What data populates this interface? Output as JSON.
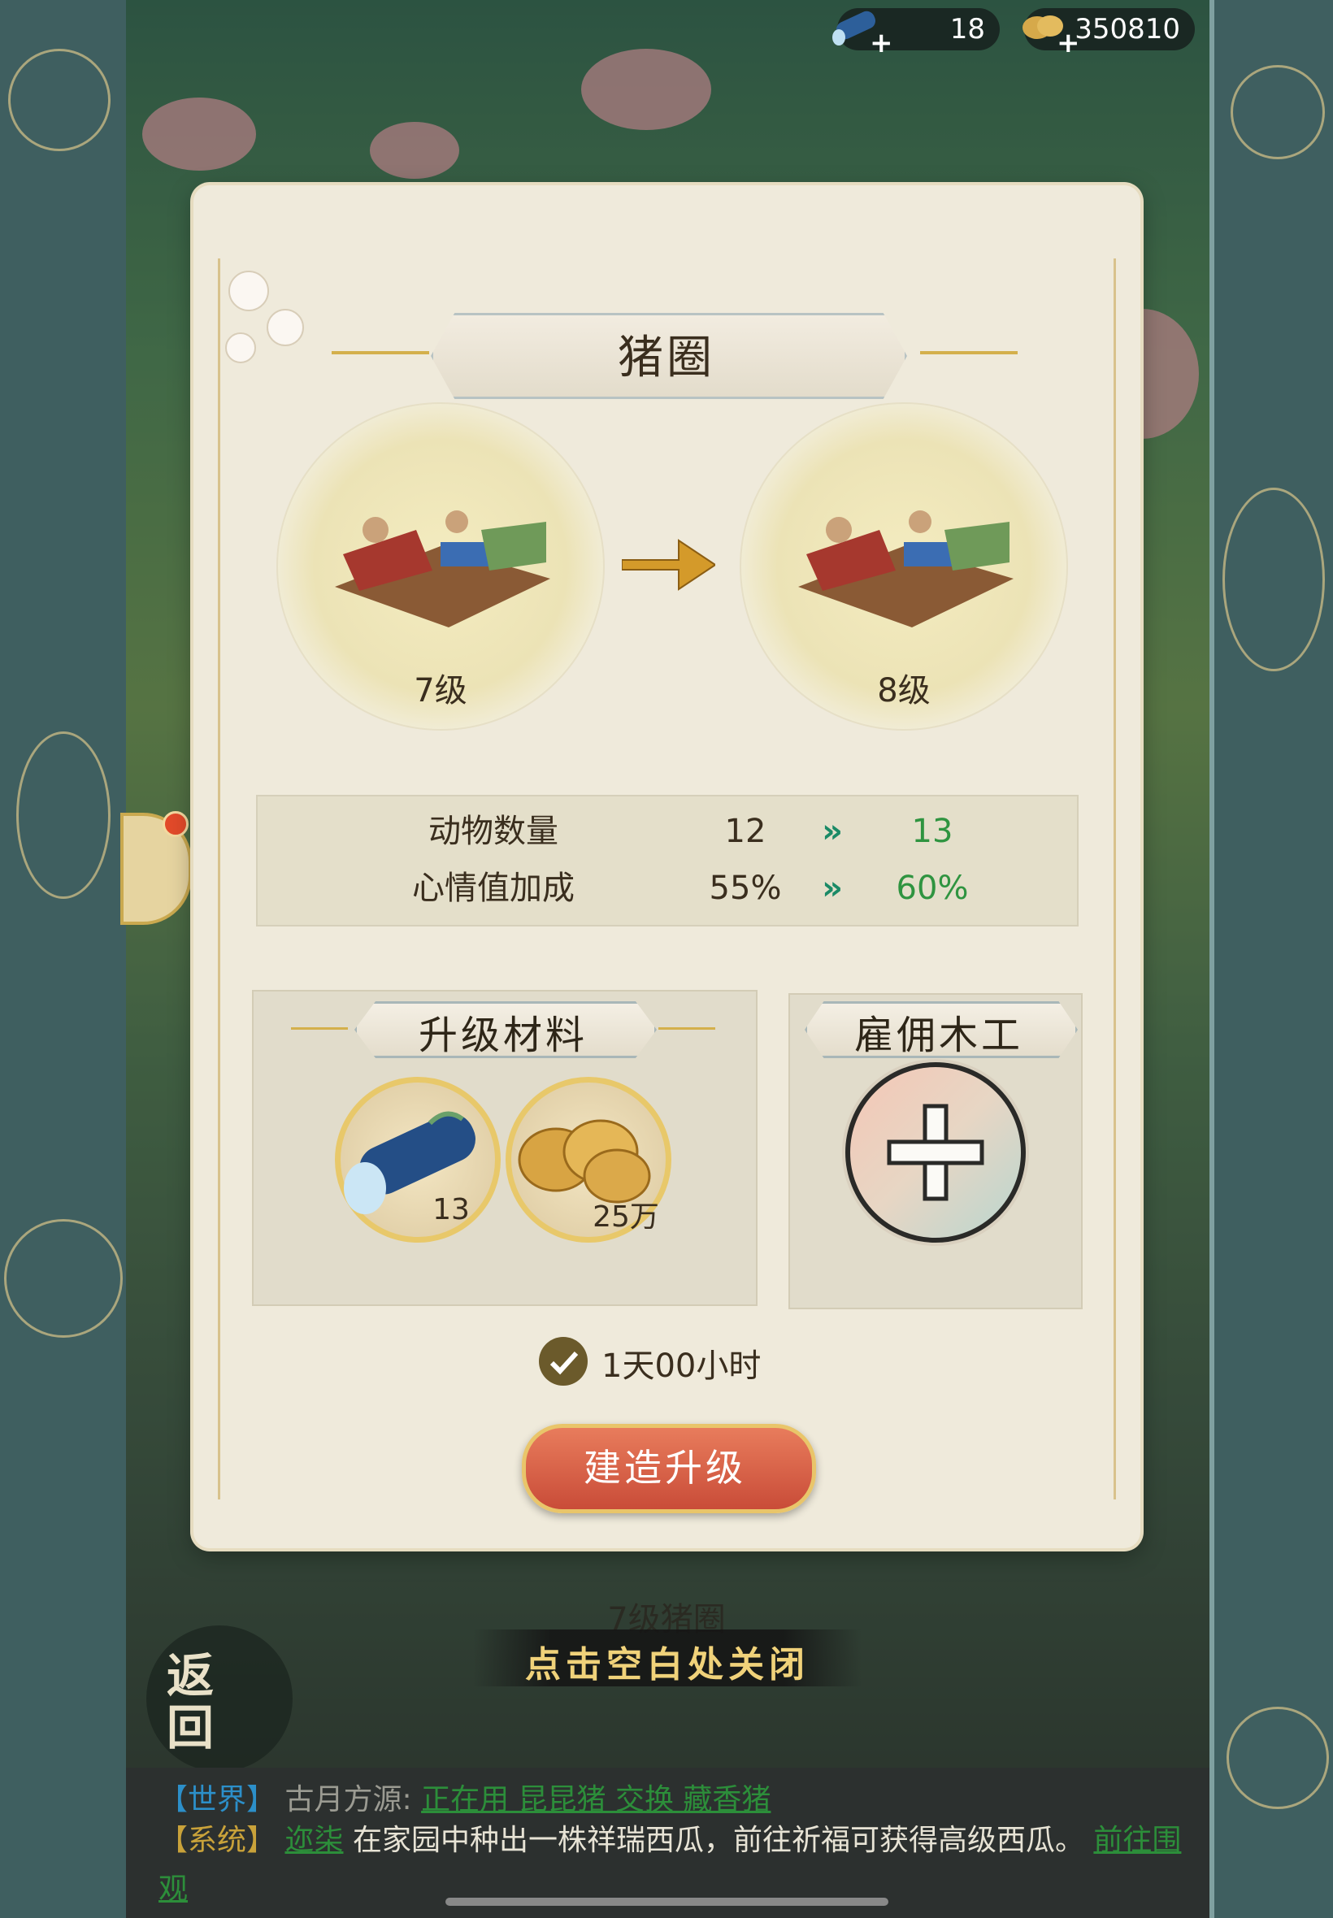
{
  "resources": {
    "wood": {
      "icon": "wood-log-icon",
      "value": "18"
    },
    "coins": {
      "icon": "coins-icon",
      "value": "350810"
    }
  },
  "building": {
    "title": "猪圈",
    "current_level": "7级",
    "next_level": "8级"
  },
  "stats": [
    {
      "label": "动物数量",
      "current": "12",
      "next": "13"
    },
    {
      "label": "心情值加成",
      "current": "55%",
      "next": "60%"
    }
  ],
  "stat_arrow": "»",
  "materials": {
    "title": "升级材料",
    "items": [
      {
        "icon": "wood-log-icon",
        "count": "13"
      },
      {
        "icon": "coins-icon",
        "count": "25万"
      }
    ]
  },
  "hire": {
    "title": "雇佣木工"
  },
  "time": {
    "icon": "clock-icon",
    "text": "1天00小时"
  },
  "build_button": "建造升级",
  "background_building_name": "7级猪圈",
  "close_hint": "点击空白处关闭",
  "back_button": "返回",
  "chat": {
    "world": {
      "tag": "【世界】",
      "speaker": "古月方源:",
      "message": "正在用 昆昆猪 交换 藏香猪"
    },
    "system": {
      "tag": "【系统】",
      "player": "迩柒",
      "message": "在家园中种出一株祥瑞西瓜，前往祈福可获得高级西瓜。",
      "link": "前往围观"
    }
  },
  "colors": {
    "accent_gold": "#e9c56a",
    "button_red": "#d55c44",
    "up_green": "#2f9440"
  }
}
